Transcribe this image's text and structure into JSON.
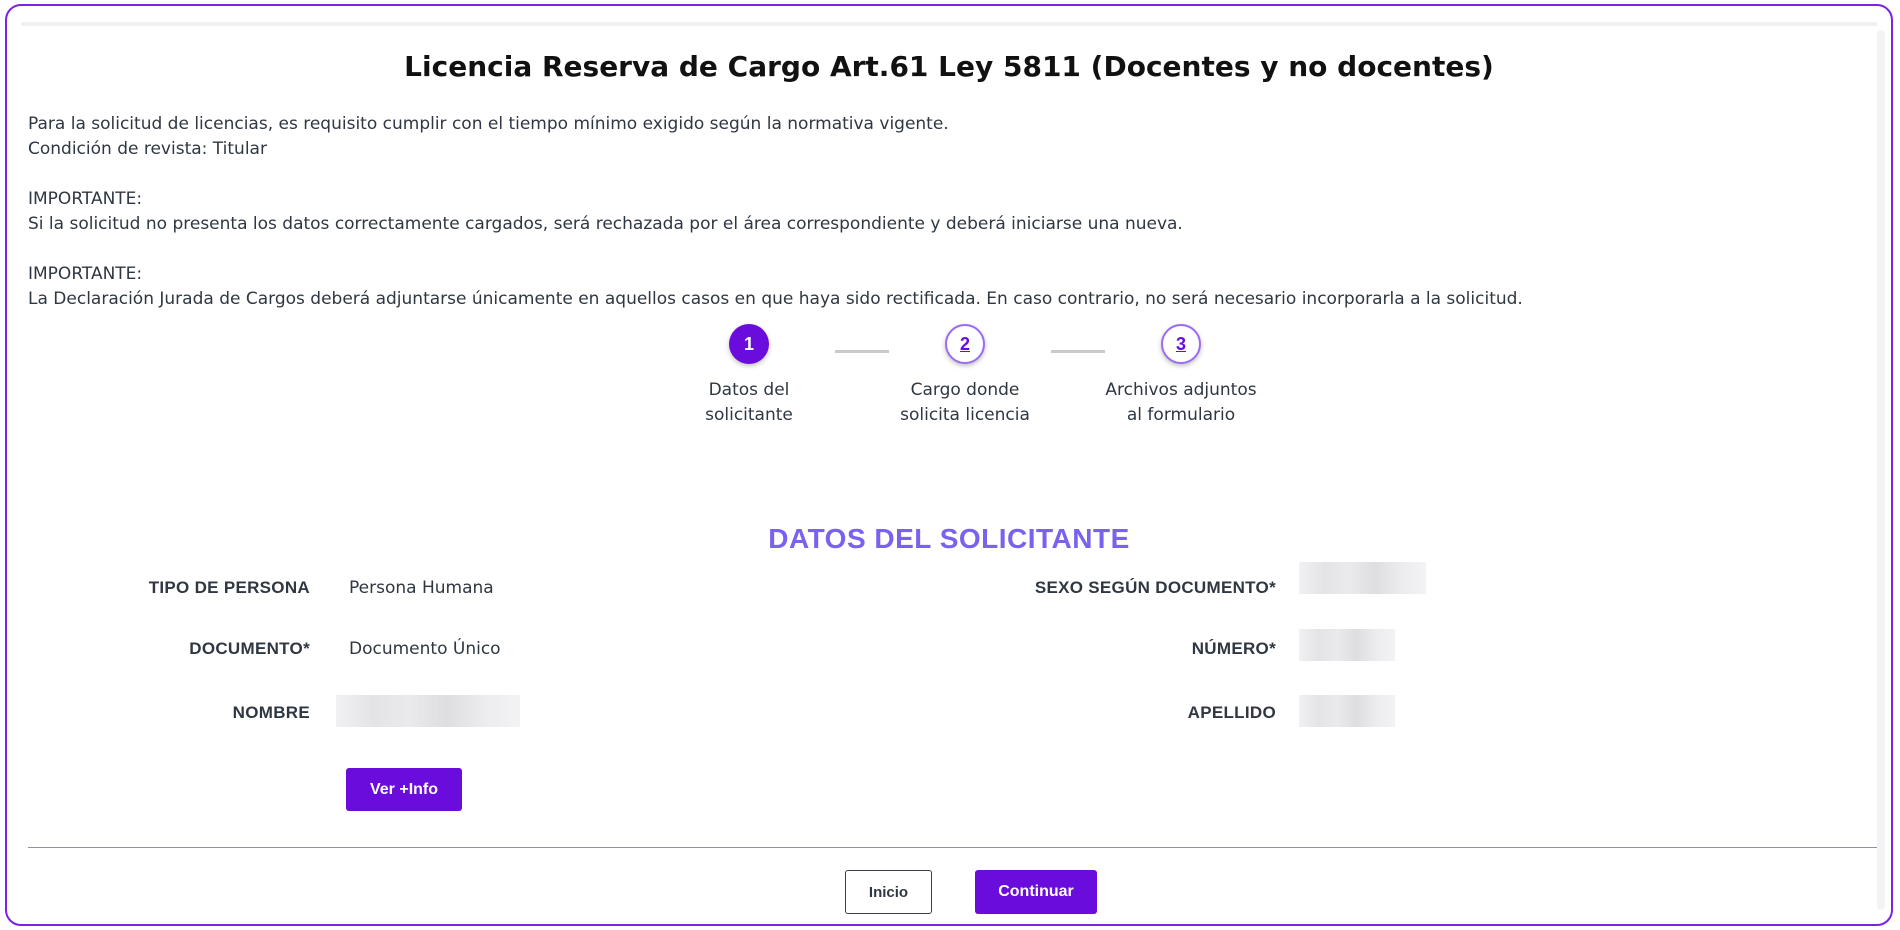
{
  "page": {
    "title": "Licencia Reserva de Cargo Art.61 Ley 5811 (Docentes y no docentes)",
    "intro_lines": [
      "Para la solicitud de licencias, es requisito cumplir con el tiempo mínimo exigido según la normativa vigente.",
      "Condición de revista: Titular",
      "",
      "IMPORTANTE:",
      "Si la solicitud no presenta los datos correctamente cargados, será rechazada por el área correspondiente y deberá iniciarse una nueva.",
      "",
      "IMPORTANTE:",
      "La Declaración Jurada de Cargos deberá adjuntarse únicamente en aquellos casos en que haya sido rectificada. En caso contrario, no será necesario incorporarla a la solicitud."
    ]
  },
  "stepper": {
    "steps": [
      {
        "number": "1",
        "line1": "Datos del",
        "line2": "solicitante",
        "state": "active"
      },
      {
        "number": "2",
        "line1": "Cargo donde",
        "line2": "solicita licencia",
        "state": "idle"
      },
      {
        "number": "3",
        "line1": "Archivos adjuntos",
        "line2": "al formulario",
        "state": "idle"
      }
    ]
  },
  "section": {
    "title": "DATOS DEL SOLICITANTE",
    "fields": {
      "tipo_persona": {
        "label": "TIPO DE PERSONA",
        "value": "Persona Humana"
      },
      "documento": {
        "label": "DOCUMENTO*",
        "value": "Documento Único"
      },
      "nombre": {
        "label": "NOMBRE",
        "value": ""
      },
      "sexo": {
        "label": "SEXO SEGÚN DOCUMENTO*",
        "value": ""
      },
      "numero": {
        "label": "NÚMERO*",
        "value": ""
      },
      "apellido": {
        "label": "APELLIDO",
        "value": ""
      }
    },
    "more_info_label": "Ver +Info"
  },
  "footer": {
    "back_label": "Inicio",
    "continue_label": "Continuar"
  },
  "colors": {
    "accent": "#6a0cdc",
    "section_title": "#7b61f0",
    "frame_border": "#7a22e6"
  }
}
